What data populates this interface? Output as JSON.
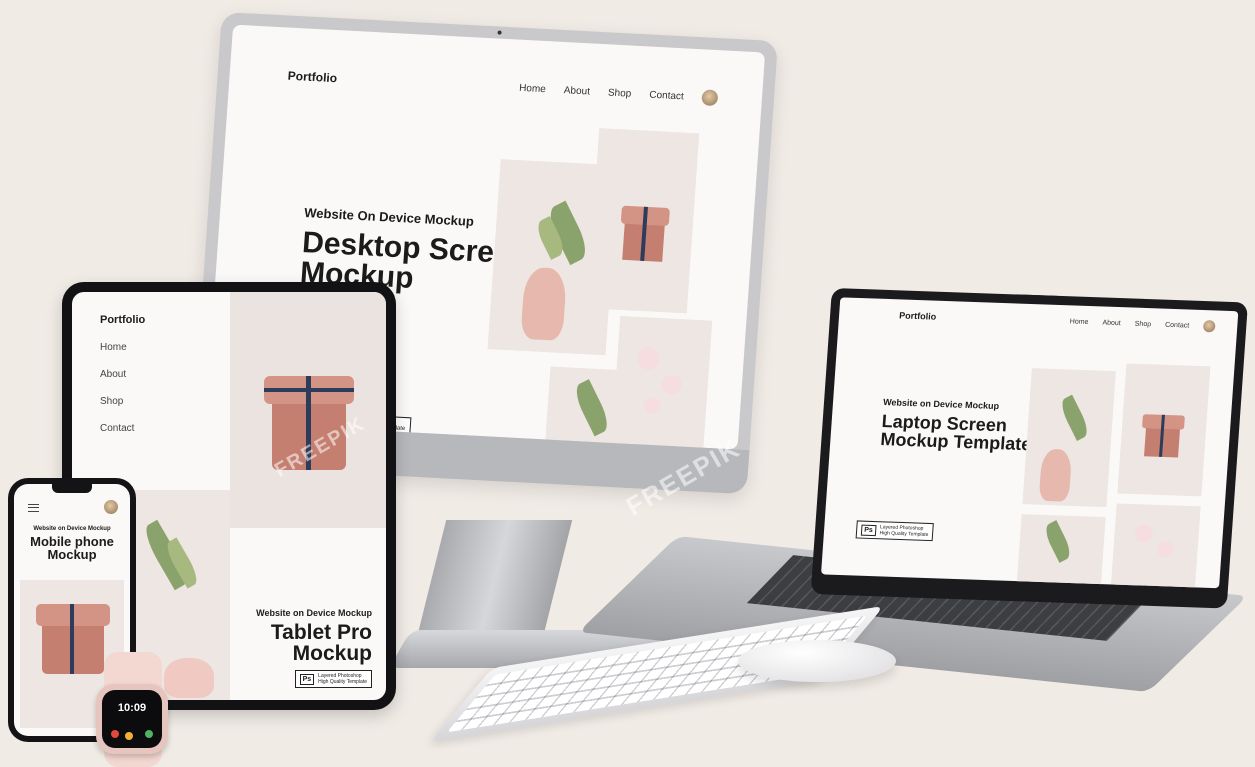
{
  "desktop": {
    "logo": "Portfolio",
    "nav": [
      "Home",
      "About",
      "Shop",
      "Contact"
    ],
    "subtitle": "Website On Device Mockup",
    "title_line1": "Desktop Screen",
    "title_line2": "Mockup",
    "badge_line1": "d Photoshop",
    "badge_line2": "Quality Template"
  },
  "laptop": {
    "logo": "Portfolio",
    "nav": [
      "Home",
      "About",
      "Shop",
      "Contact"
    ],
    "subtitle": "Website on Device Mockup",
    "title_line1": "Laptop Screen",
    "title_line2": "Mockup Template",
    "badge_icon": "Ps",
    "badge_line1": "Layered Photoshop",
    "badge_line2": "High Quality Template"
  },
  "tablet": {
    "logo": "Portfolio",
    "menu": [
      "Home",
      "About",
      "Shop",
      "Contact"
    ],
    "subtitle": "Website on Device Mockup",
    "title_line1": "Tablet Pro",
    "title_line2": "Mockup",
    "badge_icon": "Ps",
    "badge_line1": "Layered Photoshop",
    "badge_line2": "High Quality Template"
  },
  "phone": {
    "subtitle": "Website on Device Mockup",
    "title_line1": "Mobile phone",
    "title_line2": "Mockup"
  },
  "watch": {
    "time": "10:09"
  },
  "watermark": "FREEPIK",
  "colors": {
    "background": "#f1ebe6",
    "accent_pink": "#c47f70",
    "ribbon_navy": "#2c3c5a"
  }
}
